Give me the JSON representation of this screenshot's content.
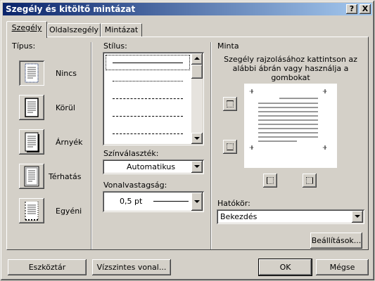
{
  "window": {
    "title": "Szegély és kitöltő mintázat",
    "help_btn": "?",
    "close_btn": "X"
  },
  "tabs": [
    {
      "label": "Szegély",
      "active": true
    },
    {
      "label": "Oldalszegély",
      "active": false
    },
    {
      "label": "Mintázat",
      "active": false
    }
  ],
  "tipus": {
    "heading": "Típus:",
    "items": [
      {
        "label": "Nincs",
        "icon": "border-none-icon"
      },
      {
        "label": "Körül",
        "icon": "border-box-icon"
      },
      {
        "label": "Árnyék",
        "icon": "border-shadow-icon"
      },
      {
        "label": "Térhatás",
        "icon": "border-3d-icon"
      },
      {
        "label": "Egyéni",
        "icon": "border-custom-icon"
      }
    ]
  },
  "stilus": {
    "heading": "Stílus:",
    "styles": [
      "solid",
      "dotted",
      "dashed-small",
      "dashed",
      "dash-dot"
    ]
  },
  "szinvalasztek": {
    "heading": "Színválaszték:",
    "value": "Automatikus"
  },
  "vonalvastagsag": {
    "heading": "Vonalvastagság:",
    "value": "0,5 pt"
  },
  "minta": {
    "heading": "Minta",
    "hint": "Szegély rajzolásához kattintson az alábbi ábrán vagy használja a gombokat"
  },
  "hatokor": {
    "heading": "Hatókör:",
    "value": "Bekezdés"
  },
  "buttons": {
    "beallitasok": "Beállítások...",
    "eszkoztar": "Eszköztár",
    "vizszintes": "Vízszintes vonal...",
    "ok": "OK",
    "megse": "Mégse"
  },
  "colors": {
    "face": "#d4d0c8",
    "title_start": "#0a246a",
    "title_end": "#a6caf0",
    "selection": "#0a246a"
  }
}
